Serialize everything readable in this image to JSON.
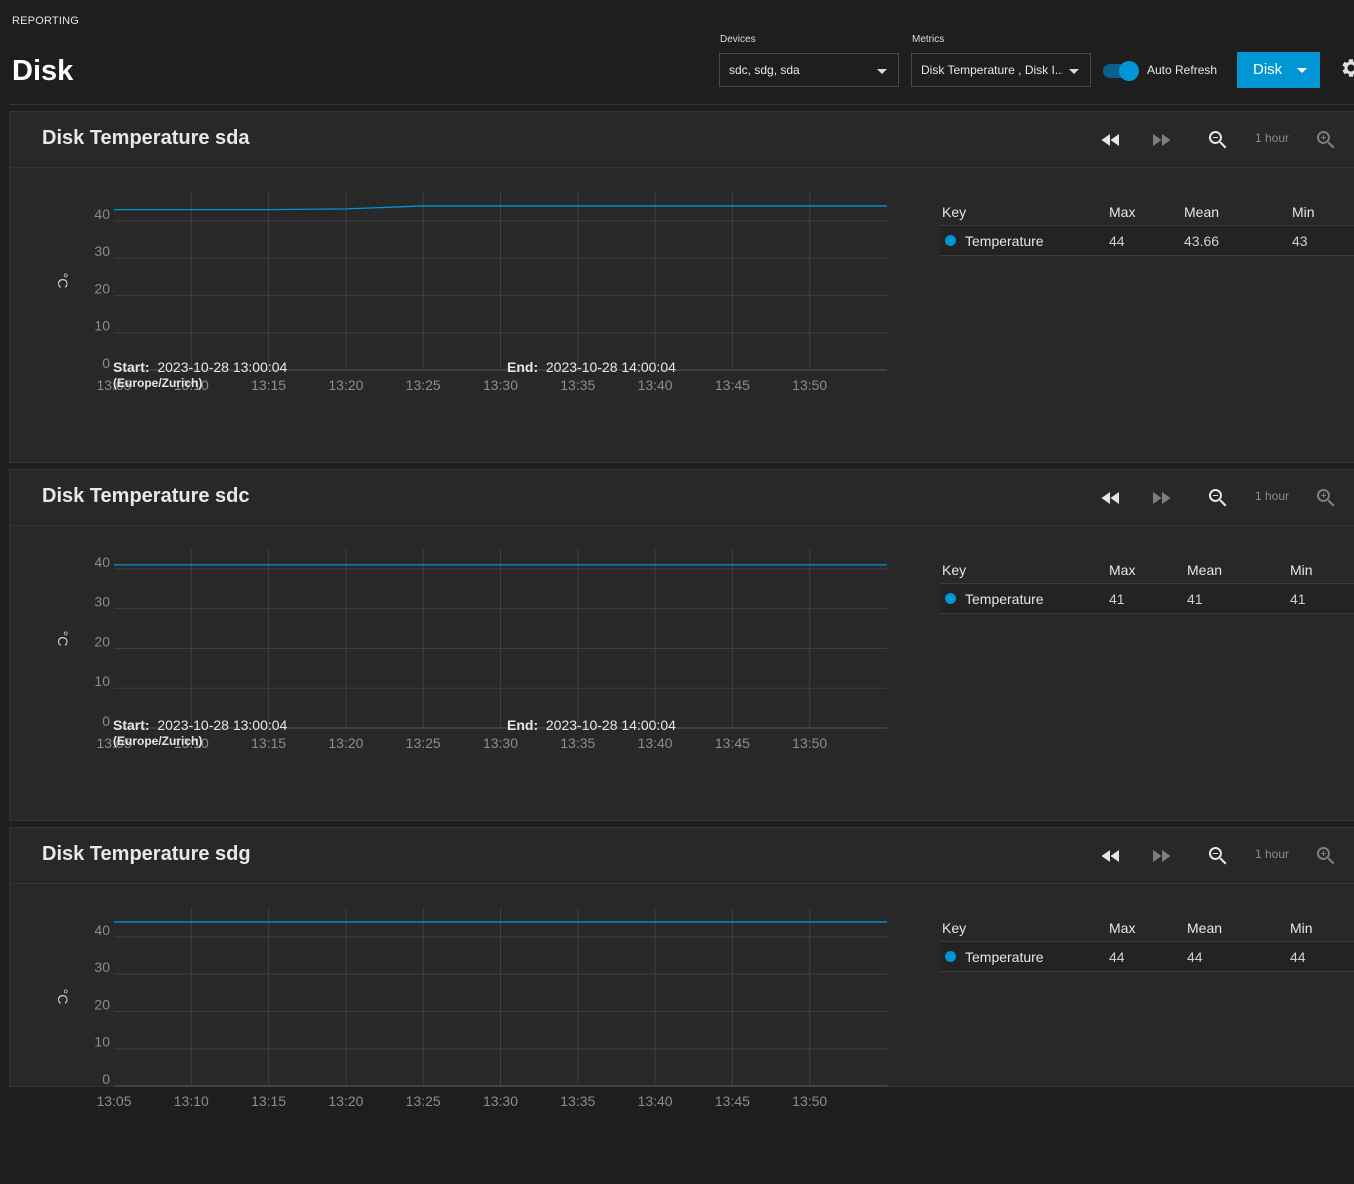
{
  "header": {
    "breadcrumb": "REPORTING",
    "title": "Disk",
    "devices_label": "Devices",
    "devices_value": "sdc, sdg, sda",
    "metrics_label": "Metrics",
    "metrics_value": "Disk Temperature , Disk I...",
    "auto_refresh_label": "Auto Refresh",
    "auto_refresh_on": true,
    "disk_button_label": "Disk"
  },
  "colors": {
    "accent": "#0095d5",
    "series": "#0095d5"
  },
  "panels": [
    {
      "title": "Disk Temperature sda",
      "zoom_label": "1 hour",
      "start_label": "Start:",
      "start": "2023-10-28 13:00:04",
      "timezone": "(Europe/Zurich)",
      "end_label": "End:",
      "end": "2023-10-28 14:00:04",
      "legend": {
        "headers": [
          "Key",
          "Max",
          "Mean",
          "Min"
        ],
        "row": {
          "key": "Temperature",
          "max": "44",
          "mean": "43.66",
          "min": "43"
        }
      }
    },
    {
      "title": "Disk Temperature sdc",
      "zoom_label": "1 hour",
      "start_label": "Start:",
      "start": "2023-10-28 13:00:04",
      "timezone": "(Europe/Zurich)",
      "end_label": "End:",
      "end": "2023-10-28 14:00:04",
      "legend": {
        "headers": [
          "Key",
          "Max",
          "Mean",
          "Min"
        ],
        "row": {
          "key": "Temperature",
          "max": "41",
          "mean": "41",
          "min": "41"
        }
      }
    },
    {
      "title": "Disk Temperature sdg",
      "zoom_label": "1 hour",
      "legend": {
        "headers": [
          "Key",
          "Max",
          "Mean",
          "Min"
        ],
        "row": {
          "key": "Temperature",
          "max": "44",
          "mean": "44",
          "min": "44"
        }
      }
    }
  ],
  "chart_data": [
    {
      "type": "line",
      "ylabel": "°C",
      "ylim": [
        0,
        48
      ],
      "yticks": [
        0,
        10,
        20,
        30,
        40
      ],
      "xlim": [
        "13:05",
        "13:55"
      ],
      "xticks": [
        "13:05",
        "13:10",
        "13:15",
        "13:20",
        "13:25",
        "13:30",
        "13:35",
        "13:40",
        "13:45",
        "13:50"
      ],
      "grid": true,
      "series": [
        {
          "name": "Temperature",
          "x": [
            "13:05",
            "13:15",
            "13:20",
            "13:25",
            "13:30",
            "13:35",
            "13:40",
            "13:45",
            "13:50",
            "13:55"
          ],
          "values": [
            43,
            43,
            43.2,
            44,
            44,
            44,
            44,
            44,
            44,
            44
          ]
        }
      ]
    },
    {
      "type": "line",
      "ylabel": "°C",
      "ylim": [
        0,
        45
      ],
      "yticks": [
        0,
        10,
        20,
        30,
        40
      ],
      "xlim": [
        "13:05",
        "13:55"
      ],
      "xticks": [
        "13:05",
        "13:10",
        "13:15",
        "13:20",
        "13:25",
        "13:30",
        "13:35",
        "13:40",
        "13:45",
        "13:50"
      ],
      "grid": true,
      "series": [
        {
          "name": "Temperature",
          "x": [
            "13:05",
            "13:55"
          ],
          "values": [
            41,
            41
          ]
        }
      ]
    },
    {
      "type": "line",
      "ylabel": "°C",
      "ylim": [
        0,
        48
      ],
      "yticks": [
        0,
        10,
        20,
        30,
        40
      ],
      "xlim": [
        "13:05",
        "13:55"
      ],
      "xticks": [
        "13:05",
        "13:10",
        "13:15",
        "13:20",
        "13:25",
        "13:30",
        "13:35",
        "13:40",
        "13:45",
        "13:50"
      ],
      "grid": true,
      "series": [
        {
          "name": "Temperature",
          "x": [
            "13:05",
            "13:55"
          ],
          "values": [
            44,
            44
          ]
        }
      ]
    }
  ]
}
